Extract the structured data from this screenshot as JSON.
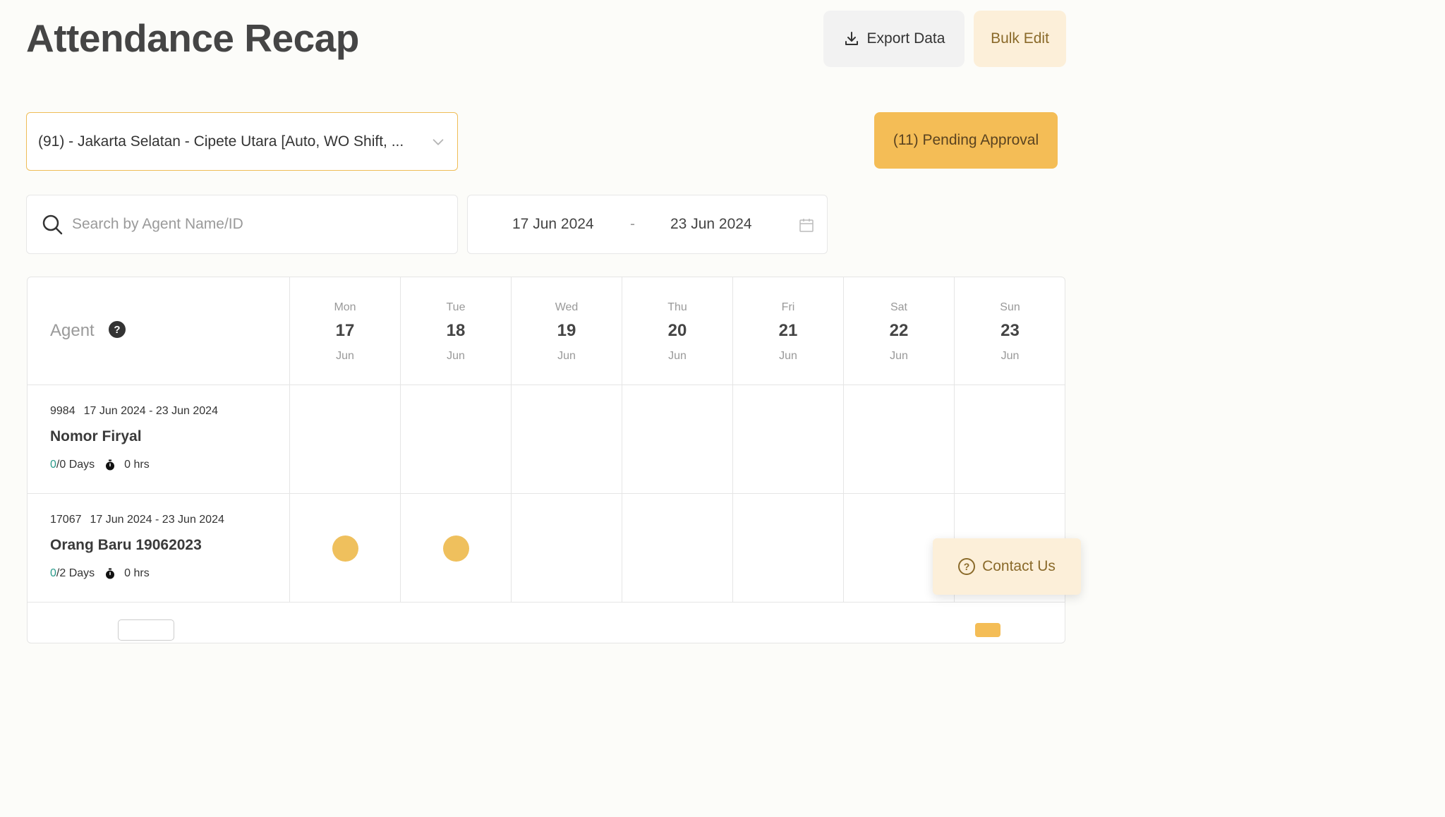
{
  "header": {
    "title": "Attendance Recap",
    "export_label": "Export Data",
    "bulk_edit_label": "Bulk Edit"
  },
  "filters": {
    "location": "(91) - Jakarta Selatan - Cipete Utara [Auto, WO Shift, ...",
    "pending_label": "(11) Pending Approval",
    "search_placeholder": "Search by Agent Name/ID",
    "date_start": "17 Jun 2024",
    "date_separator": "-",
    "date_end": "23 Jun 2024"
  },
  "table": {
    "agent_header": "Agent",
    "help_glyph": "?",
    "days": [
      {
        "dow": "Mon",
        "num": "17",
        "month": "Jun"
      },
      {
        "dow": "Tue",
        "num": "18",
        "month": "Jun"
      },
      {
        "dow": "Wed",
        "num": "19",
        "month": "Jun"
      },
      {
        "dow": "Thu",
        "num": "20",
        "month": "Jun"
      },
      {
        "dow": "Fri",
        "num": "21",
        "month": "Jun"
      },
      {
        "dow": "Sat",
        "num": "22",
        "month": "Jun"
      },
      {
        "dow": "Sun",
        "num": "23",
        "month": "Jun"
      }
    ],
    "agents": [
      {
        "id": "9984",
        "period": "17 Jun 2024 - 23 Jun 2024",
        "name": "Nomor Firyal",
        "present": "0",
        "total": "/0 Days",
        "hours": "0 hrs",
        "marks": []
      },
      {
        "id": "17067",
        "period": "17 Jun 2024 - 23 Jun 2024",
        "name": "Orang Baru 19062023",
        "present": "0",
        "total": "/2 Days",
        "hours": "0 hrs",
        "marks": [
          "Mon",
          "Tue"
        ]
      }
    ]
  },
  "contact": {
    "label": "Contact Us",
    "icon_glyph": "?"
  },
  "colors": {
    "accent": "#f4bd56",
    "accent_light": "#fcefd9",
    "attendance_dot": "#efc05d",
    "present_count": "#2a9a8a"
  },
  "icons": {
    "export": "download-icon",
    "location": "chevron-down-icon",
    "search": "search-icon",
    "date": "calendar-icon",
    "help": "help-circle-icon",
    "timer": "stopwatch-icon",
    "contact": "question-circle-icon"
  }
}
